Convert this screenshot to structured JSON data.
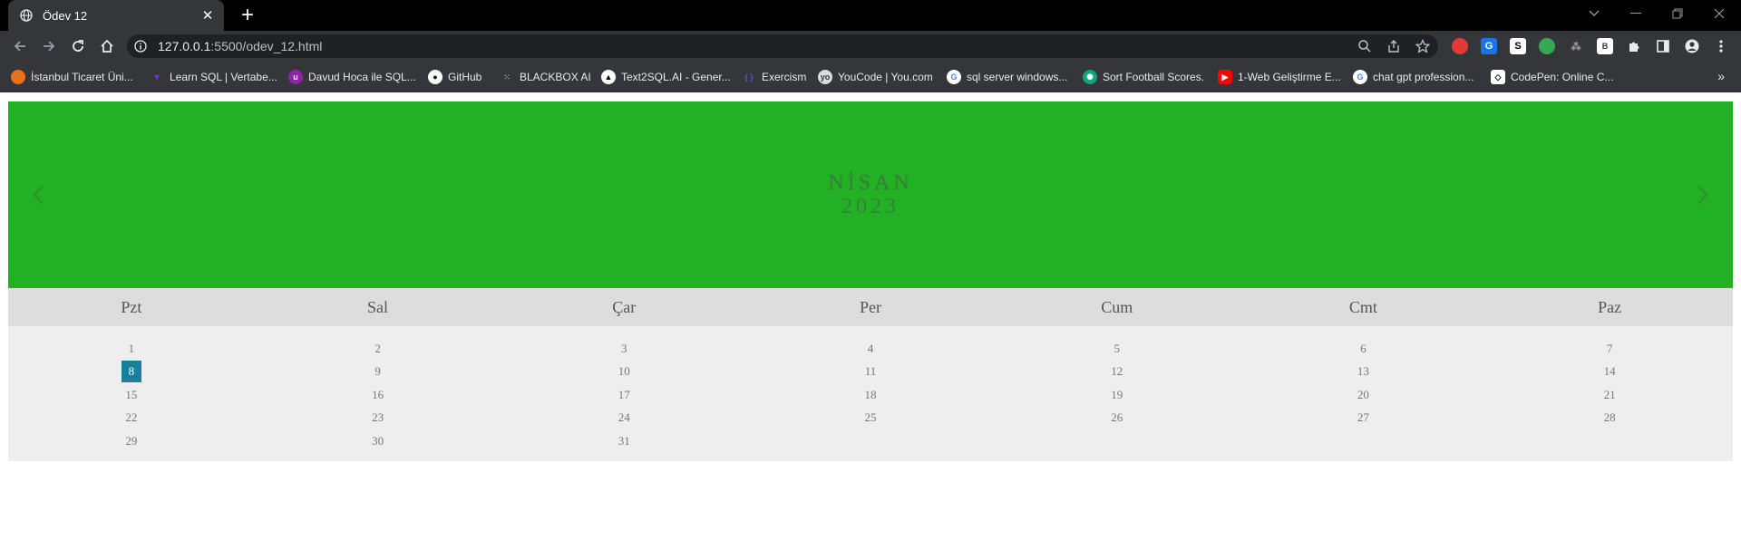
{
  "browser": {
    "tab_title": "Ödev 12",
    "url_host": "127.0.0.1",
    "url_rest": ":5500/odev_12.html"
  },
  "bookmarks": [
    {
      "label": "İstanbul Ticaret Üni...",
      "color": "#e8711c"
    },
    {
      "label": "Learn SQL | Vertabe...",
      "color": "#7b2ff7"
    },
    {
      "label": "Davud Hoca ile SQL...",
      "color": "#8e24aa"
    },
    {
      "label": "GitHub",
      "color": "#ffffff"
    },
    {
      "label": "BLACKBOX AI",
      "color": "#9aa0a6"
    },
    {
      "label": "Text2SQL.AI - Gener...",
      "color": "#ffffff"
    },
    {
      "label": "Exercism",
      "color": "#604fcd"
    },
    {
      "label": "YouCode | You.com",
      "color": "#dadce0"
    },
    {
      "label": "sql server windows...",
      "color": "#4285f4"
    },
    {
      "label": "Sort Football Scores.",
      "color": "#10a37f"
    },
    {
      "label": "1-Web Geliştirme E...",
      "color": "#ff0000"
    },
    {
      "label": "chat gpt profession...",
      "color": "#4285f4"
    },
    {
      "label": "CodePen: Online C...",
      "color": "#ffffff"
    }
  ],
  "calendar": {
    "month": "NİSAN",
    "year": "2023",
    "header_color": "#22b125",
    "weekdays": [
      "Pzt",
      "Sal",
      "Çar",
      "Per",
      "Cum",
      "Cmt",
      "Paz"
    ],
    "days": [
      "1",
      "2",
      "3",
      "4",
      "5",
      "6",
      "7",
      "8",
      "9",
      "10",
      "11",
      "12",
      "13",
      "14",
      "15",
      "16",
      "17",
      "18",
      "19",
      "20",
      "21",
      "22",
      "23",
      "24",
      "25",
      "26",
      "27",
      "28",
      "29",
      "30",
      "31"
    ],
    "active_day": "8",
    "active_color": "#1a7f9a"
  }
}
